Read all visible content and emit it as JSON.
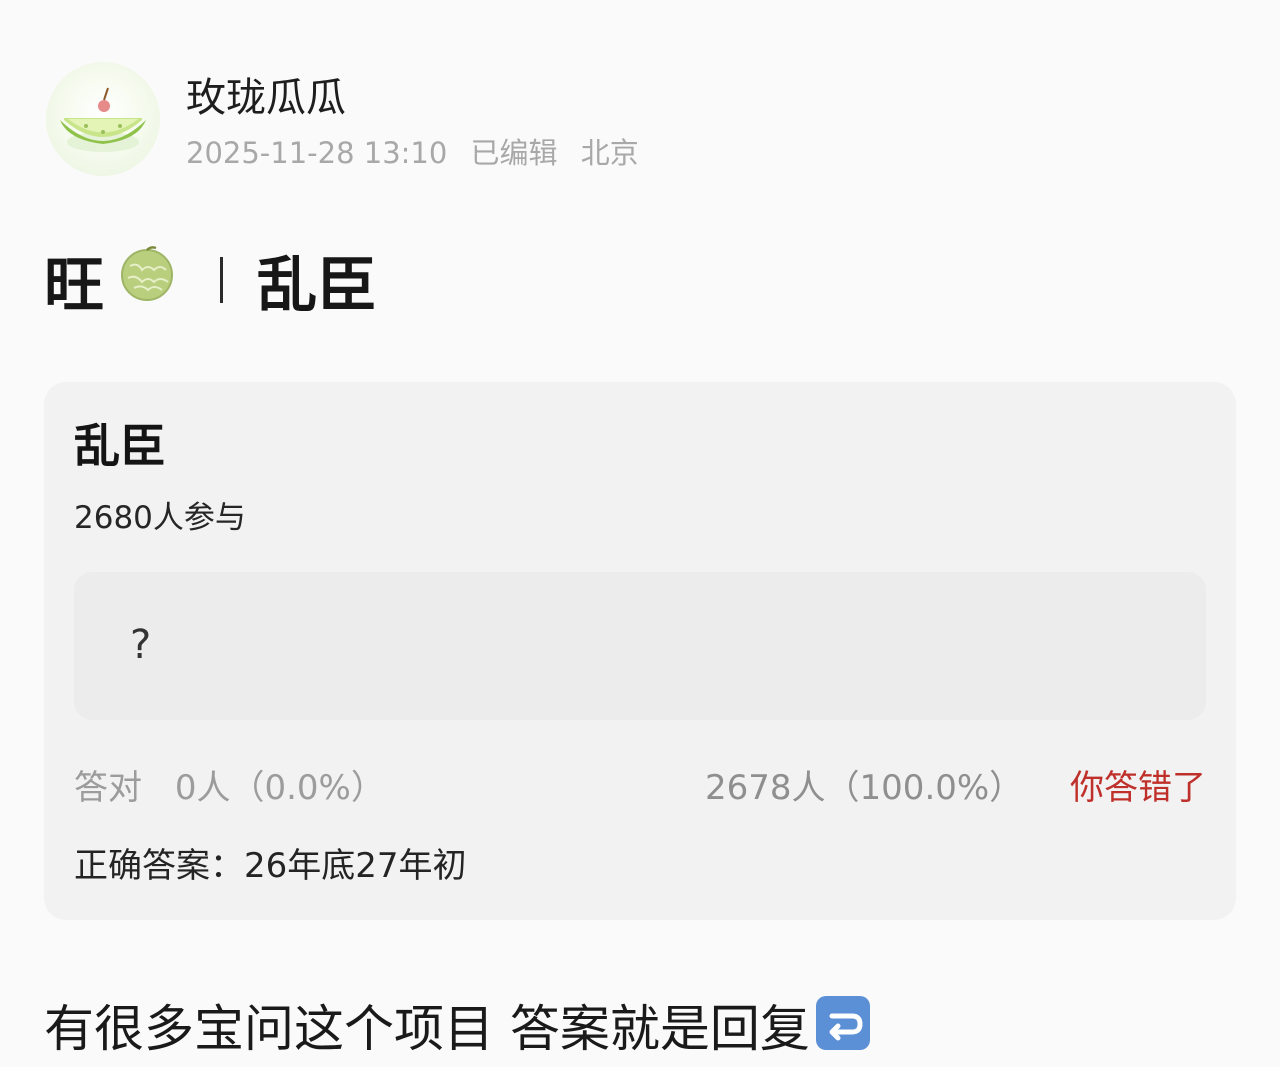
{
  "author": {
    "name": "玫珑瓜瓜",
    "timestamp": "2025-11-28 13:10",
    "edited": "已编辑",
    "location": "北京",
    "avatar_icon": "melon-avatar-icon"
  },
  "post": {
    "title_left": "旺",
    "title_icon": "melon-icon",
    "title_right": "乱臣",
    "body_text": "有很多宝问这个项目 答案就是回复",
    "body_icon": "return-arrow-icon"
  },
  "quiz": {
    "title": "乱臣",
    "participants": "2680人参与",
    "question": "?",
    "correct_label": "答对",
    "correct_stat": "0人（0.0%）",
    "wrong_stat": "2678人（100.0%）",
    "result": "你答错了",
    "answer_label": "正确答案：",
    "answer_value": "26年底27年初"
  },
  "colors": {
    "accent_red": "#c0302b",
    "muted_gray": "#a8a8a8",
    "card_bg": "#f2f2f2"
  }
}
